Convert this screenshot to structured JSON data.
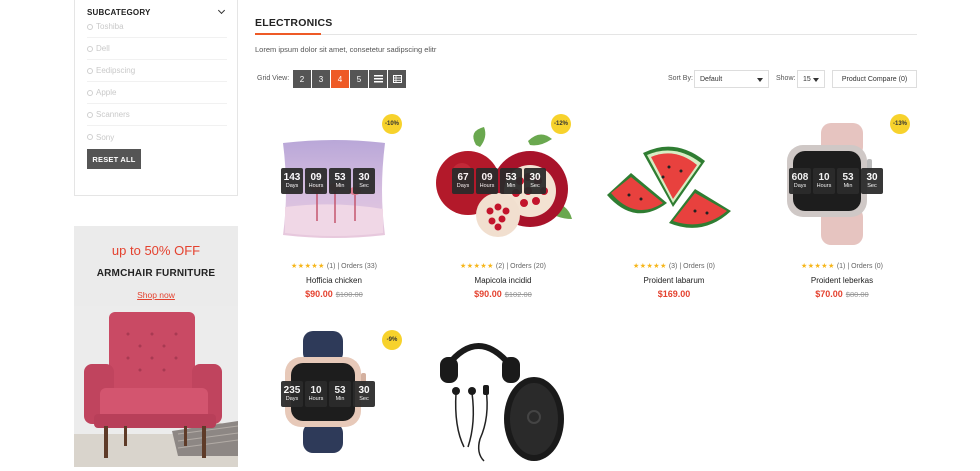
{
  "sidebar": {
    "subcategory_title": "SUBCATEGORY",
    "subcategories": [
      "Toshiba",
      "Dell",
      "Eedipscing",
      "Apple",
      "Scanners",
      "Sony"
    ],
    "reset_label": "RESET ALL"
  },
  "promo": {
    "headline": "up to 50% OFF",
    "subtitle": "ARMCHAIR FURNITURE",
    "link": "Shop now"
  },
  "main": {
    "title": "ELECTRONICS",
    "description": "Lorem ipsum dolor sit amet, consetetur sadipscing elitr"
  },
  "toolbar": {
    "grid_view_label": "Grid View:",
    "grid_options": [
      "2",
      "3",
      "4",
      "5"
    ],
    "active_grid": "4",
    "list_icon": "list-icon",
    "table_icon": "table-icon",
    "sort_label": "Sort By:",
    "sort_value": "Default",
    "show_label": "Show:",
    "show_value": "15",
    "compare_label": "Product Compare (0)"
  },
  "countdown_labels": {
    "days": "Days",
    "hours": "Hours",
    "min": "Min",
    "sec": "Sec"
  },
  "products": [
    {
      "name": "Hofficia chicken",
      "badge": "-10%",
      "rating_count": "(1)",
      "orders": "Orders (33)",
      "price": "$90.00",
      "old_price": "$100.00",
      "countdown": [
        "143",
        "09",
        "53",
        "30"
      ],
      "image": "pillow"
    },
    {
      "name": "Mapicola incidid",
      "badge": "-12%",
      "rating_count": "(2)",
      "orders": "Orders (20)",
      "price": "$90.00",
      "old_price": "$102.00",
      "countdown": [
        "67",
        "09",
        "53",
        "30"
      ],
      "image": "pomegranate"
    },
    {
      "name": "Proident labarum",
      "badge": "",
      "rating_count": "(3)",
      "orders": "Orders (0)",
      "price": "$169.00",
      "old_price": "",
      "countdown": [],
      "image": "watermelon"
    },
    {
      "name": "Proident leberkas",
      "badge": "-13%",
      "rating_count": "(1)",
      "orders": "Orders (0)",
      "price": "$70.00",
      "old_price": "$80.00",
      "countdown": [
        "608",
        "10",
        "53",
        "30"
      ],
      "image": "watch-pink"
    },
    {
      "name": "",
      "badge": "-9%",
      "rating_count": "",
      "orders": "",
      "price": "",
      "old_price": "",
      "countdown": [
        "235",
        "10",
        "53",
        "30"
      ],
      "image": "watch-navy"
    },
    {
      "name": "",
      "badge": "",
      "rating_count": "",
      "orders": "",
      "price": "",
      "old_price": "",
      "countdown": [],
      "image": "headphones"
    }
  ],
  "rating_stars": "★★★★★",
  "orders_separator": "|",
  "colors": {
    "accent": "#ee5a26",
    "price": "#e4422f",
    "badge": "#f7d22c",
    "star": "#f6b61b",
    "button": "#555555"
  }
}
